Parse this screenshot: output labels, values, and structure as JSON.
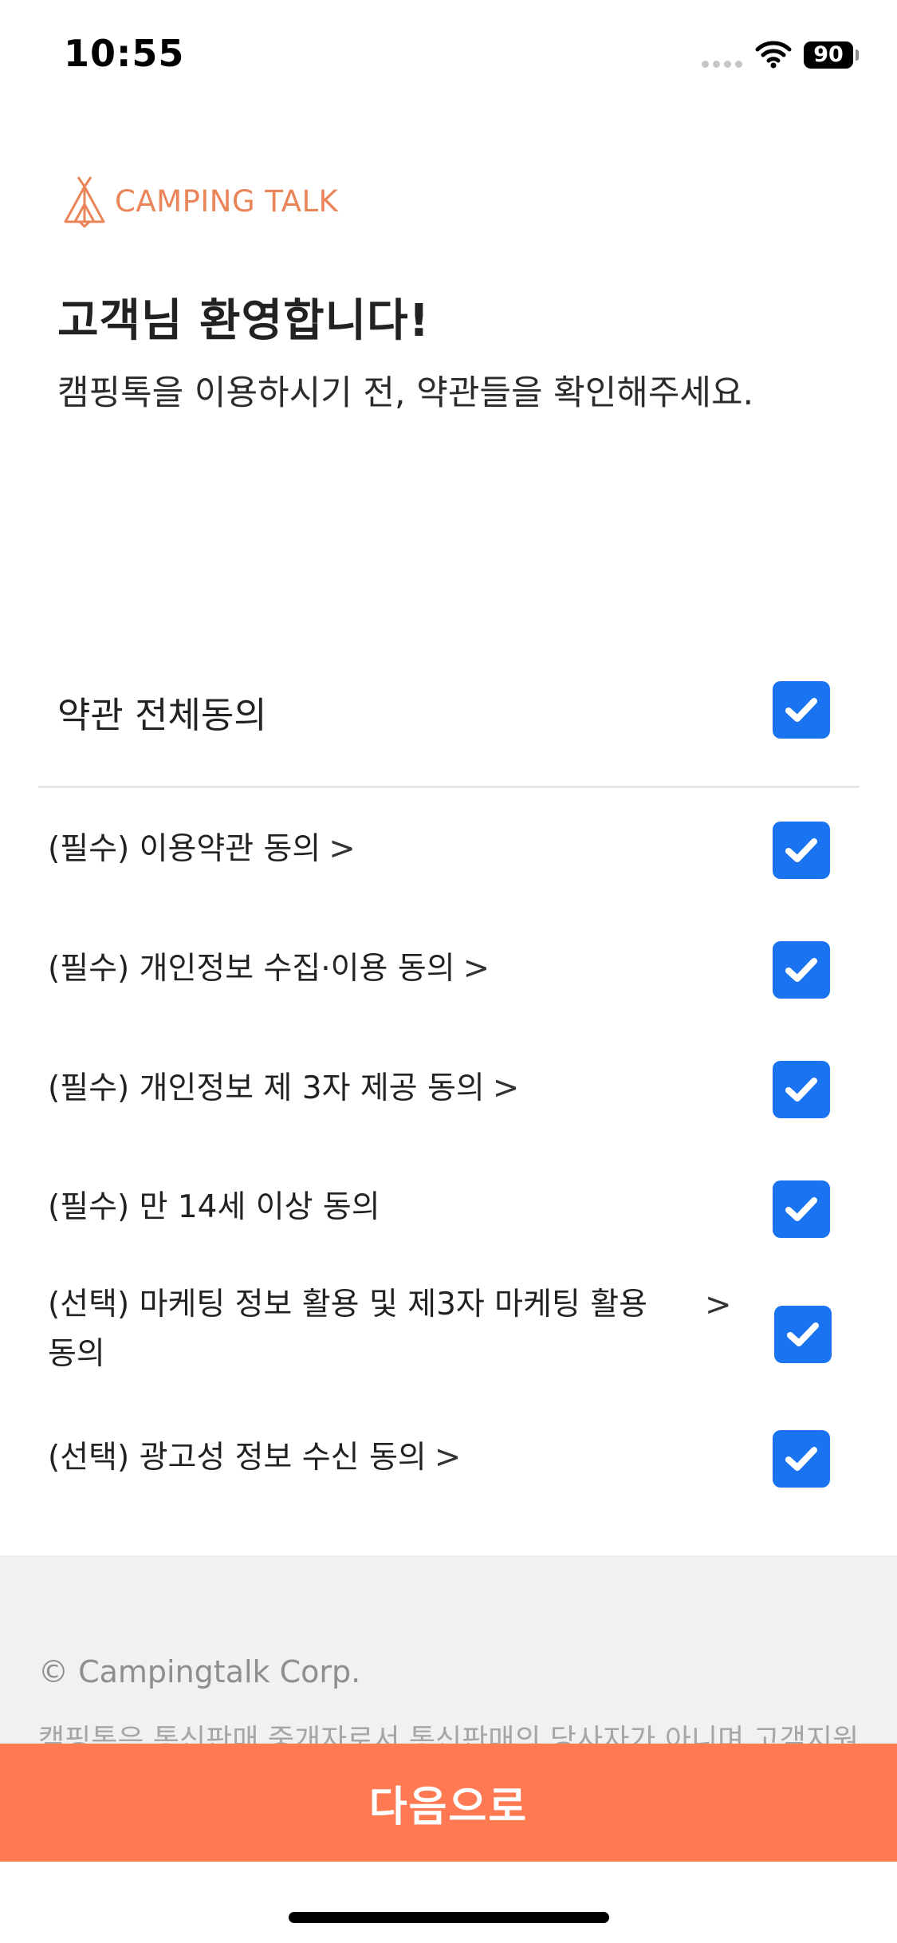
{
  "status_bar": {
    "time": "10:55",
    "battery": "90"
  },
  "brand": {
    "logo_text": "CAMPING TALK",
    "accent_color": "#ea8459"
  },
  "welcome": {
    "title": "고객님 환영합니다!",
    "subtitle": "캠핑톡을 이용하시기 전, 약관들을 확인해주세요."
  },
  "all_agree": {
    "label": "약관 전체동의",
    "checked": true
  },
  "terms": [
    {
      "label": "(필수) 이용약관 동의",
      "has_link": true,
      "checked": true
    },
    {
      "label": "(필수) 개인정보 수집·이용 동의",
      "has_link": true,
      "checked": true
    },
    {
      "label": "(필수) 개인정보 제 3자 제공 동의",
      "has_link": true,
      "checked": true
    },
    {
      "label": "(필수) 만 14세 이상 동의",
      "has_link": false,
      "checked": true
    },
    {
      "label": "(선택) 마케팅 정보 활용 및 제3자 마케팅 활용 동의",
      "has_link": true,
      "checked": true
    },
    {
      "label": "(선택) 광고성 정보 수신 동의",
      "has_link": true,
      "checked": true
    }
  ],
  "icons": {
    "chevron": "chevron-right-icon",
    "check": "checkmark-icon"
  },
  "footer": {
    "copyright": "© Campingtalk Corp.",
    "notice": "캠핑톡은 통신판매 중개자로서 통신판매의 당사자가 아니며 고객지원"
  },
  "next_button": {
    "label": "다음으로",
    "color": "#ff7a53"
  },
  "checkbox_color": "#1a73f0"
}
